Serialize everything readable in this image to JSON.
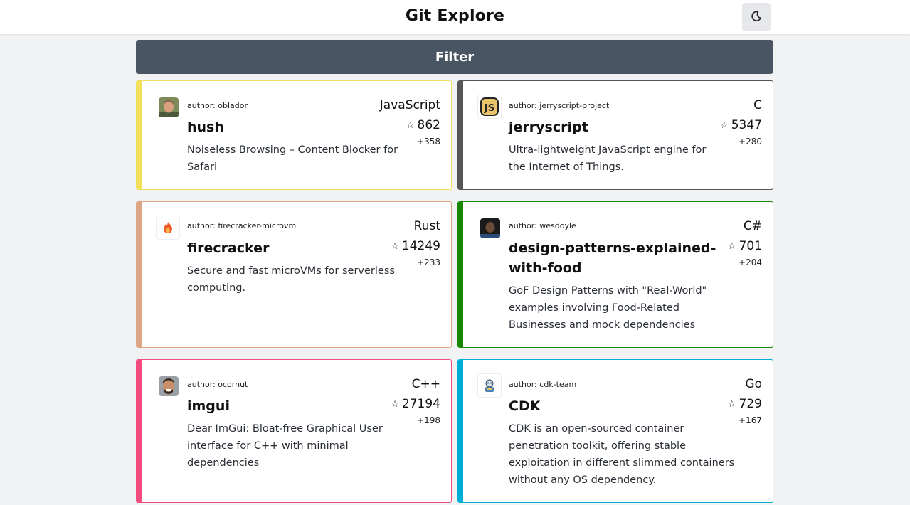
{
  "header": {
    "title": "Git Explore",
    "theme_toggle_icon": "moon-icon"
  },
  "filter": {
    "label": "Filter"
  },
  "repos": [
    {
      "author_label": "author:",
      "author": "oblador",
      "name": "hush",
      "language": "JavaScript",
      "stars": "862",
      "delta": "+358",
      "description": "Noiseless Browsing – Content Blocker for Safari",
      "color": "#f1e05a"
    },
    {
      "author_label": "author:",
      "author": "jerryscript-project",
      "name": "jerryscript",
      "language": "C",
      "stars": "5347",
      "delta": "+280",
      "description": "Ultra-lightweight JavaScript engine for the Internet of Things.",
      "color": "#555555"
    },
    {
      "author_label": "author:",
      "author": "firecracker-microvm",
      "name": "firecracker",
      "language": "Rust",
      "stars": "14249",
      "delta": "+233",
      "description": "Secure and fast microVMs for serverless computing.",
      "color": "#dea584"
    },
    {
      "author_label": "author:",
      "author": "wesdoyle",
      "name": "design-patterns-explained-with-food",
      "language": "C#",
      "stars": "701",
      "delta": "+204",
      "description": "GoF Design Patterns with \"Real-World\" examples involving Food-Related Businesses and mock dependencies",
      "color": "#178600"
    },
    {
      "author_label": "author:",
      "author": "ocornut",
      "name": "imgui",
      "language": "C++",
      "stars": "27194",
      "delta": "+198",
      "description": "Dear ImGui: Bloat-free Graphical User interface for C++ with minimal dependencies",
      "color": "#f34b7d"
    },
    {
      "author_label": "author:",
      "author": "cdk-team",
      "name": "CDK",
      "language": "Go",
      "stars": "729",
      "delta": "+167",
      "description": "CDK is an open-sourced container penetration toolkit, offering stable exploitation in different slimmed containers without any OS dependency.",
      "color": "#00add8"
    }
  ]
}
